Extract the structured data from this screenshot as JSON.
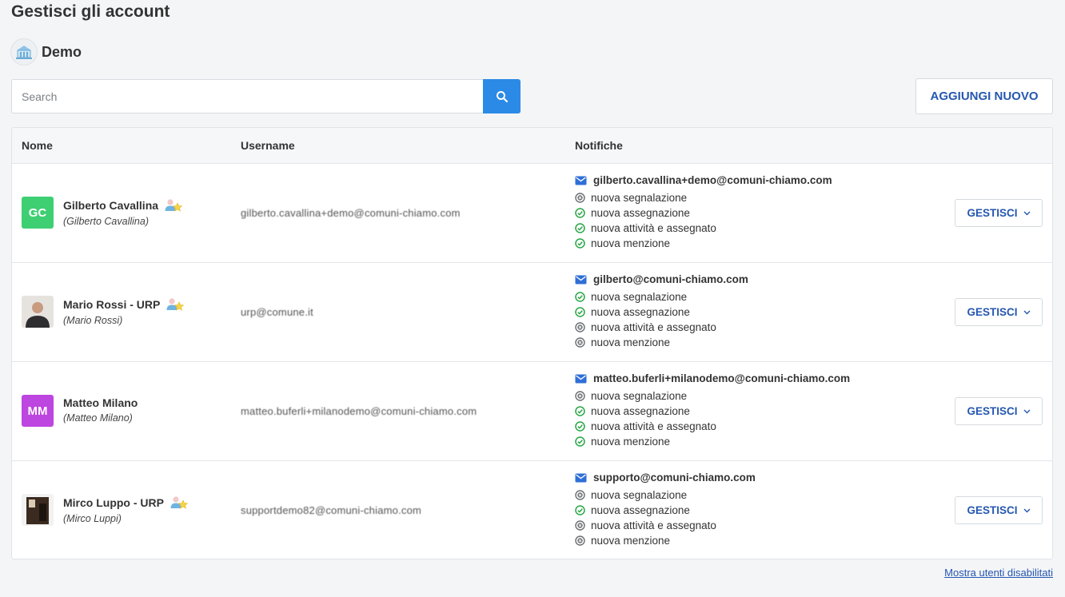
{
  "page": {
    "title": "Gestisci gli account",
    "organization": "Demo"
  },
  "search": {
    "placeholder": "Search",
    "value": ""
  },
  "toolbar": {
    "add_label": "AGGIUNGI NUOVO"
  },
  "table": {
    "columns": [
      "Nome",
      "Username",
      "Notifiche"
    ],
    "rows": [
      {
        "initials": "GC",
        "avatar_color": "#3ecf73",
        "avatar_type": "initials",
        "name": "Gilberto Cavallina",
        "sub_name": "(Gilberto Cavallina)",
        "admin": true,
        "username": "gilberto.cavallina+demo@comuni-chiamo.com",
        "email": "gilberto.cavallina+demo@comuni-chiamo.com",
        "notifications": [
          {
            "label": "nuova segnalazione",
            "enabled": false
          },
          {
            "label": "nuova assegnazione",
            "enabled": true
          },
          {
            "label": "nuova attività e assegnato",
            "enabled": true
          },
          {
            "label": "nuova menzione",
            "enabled": true
          }
        ],
        "action_label": "GESTISCI"
      },
      {
        "initials": "",
        "avatar_color": "#d9d9d9",
        "avatar_type": "photo",
        "name": "Mario Rossi - URP",
        "sub_name": "(Mario  Rossi)",
        "admin": true,
        "username": "urp@comune.it",
        "email": "gilberto@comuni-chiamo.com",
        "notifications": [
          {
            "label": "nuova segnalazione",
            "enabled": true
          },
          {
            "label": "nuova assegnazione",
            "enabled": true
          },
          {
            "label": "nuova attività e assegnato",
            "enabled": false
          },
          {
            "label": "nuova menzione",
            "enabled": false
          }
        ],
        "action_label": "GESTISCI"
      },
      {
        "initials": "MM",
        "avatar_color": "#bd45e0",
        "avatar_type": "initials",
        "name": "Matteo Milano",
        "sub_name": "(Matteo Milano)",
        "admin": false,
        "username": "matteo.buferli+milanodemo@comuni-chiamo.com",
        "email": "matteo.buferli+milanodemo@comuni-chiamo.com",
        "notifications": [
          {
            "label": "nuova segnalazione",
            "enabled": false
          },
          {
            "label": "nuova assegnazione",
            "enabled": true
          },
          {
            "label": "nuova attività e assegnato",
            "enabled": true
          },
          {
            "label": "nuova menzione",
            "enabled": true
          }
        ],
        "action_label": "GESTISCI"
      },
      {
        "initials": "",
        "avatar_color": "#3a2a20",
        "avatar_type": "photo-dark",
        "name": "Mirco Luppo - URP",
        "sub_name": "(Mirco Luppi)",
        "admin": true,
        "username": "supportdemo82@comuni-chiamo.com",
        "email": "supporto@comuni-chiamo.com",
        "notifications": [
          {
            "label": "nuova segnalazione",
            "enabled": false
          },
          {
            "label": "nuova assegnazione",
            "enabled": true
          },
          {
            "label": "nuova attività e assegnato",
            "enabled": false
          },
          {
            "label": "nuova menzione",
            "enabled": false
          }
        ],
        "action_label": "GESTISCI"
      }
    ]
  },
  "footer": {
    "show_disabled_label": "Mostra utenti disabilitati"
  },
  "icons": {
    "search": "search-icon",
    "email": "envelope-icon",
    "enabled": "check-circle-icon",
    "disabled": "x-circle-icon",
    "admin": "admin-user-star-icon",
    "chevron": "chevron-down-icon",
    "org": "town-hall-icon"
  },
  "colors": {
    "accent": "#2b8ae6",
    "link": "#2557b0",
    "enabled": "#28a745",
    "disabled": "#6b6f73"
  }
}
